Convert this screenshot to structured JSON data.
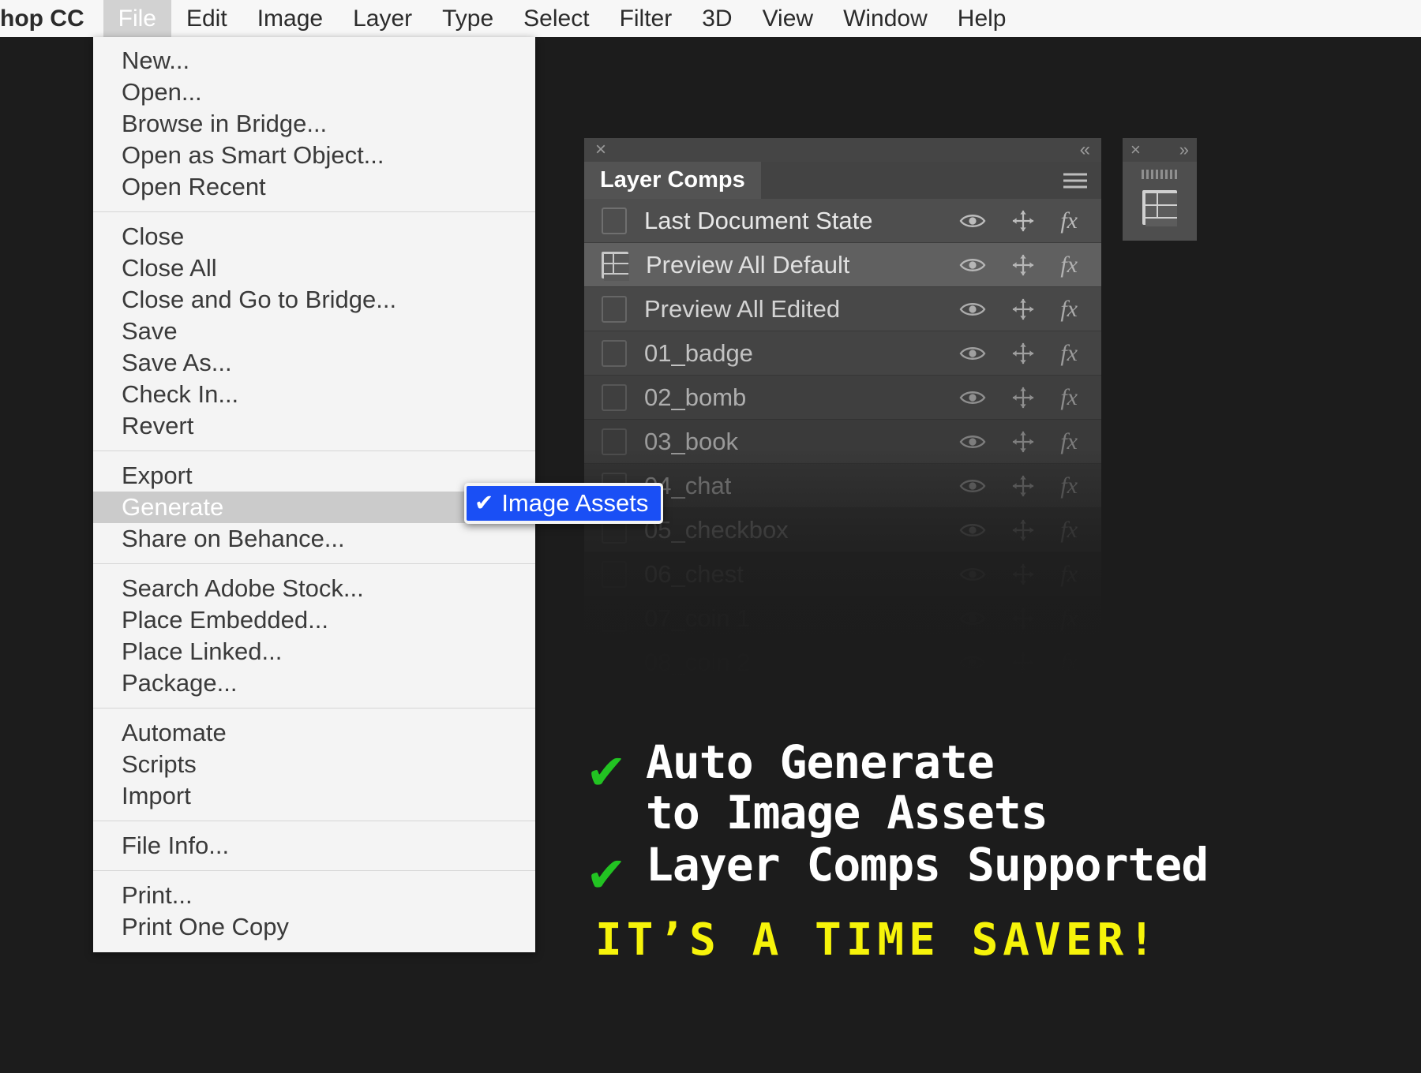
{
  "menubar": {
    "app_label": "hop CC",
    "items": [
      {
        "label": "File",
        "active": true
      },
      {
        "label": "Edit",
        "active": false
      },
      {
        "label": "Image",
        "active": false
      },
      {
        "label": "Layer",
        "active": false
      },
      {
        "label": "Type",
        "active": false
      },
      {
        "label": "Select",
        "active": false
      },
      {
        "label": "Filter",
        "active": false
      },
      {
        "label": "3D",
        "active": false
      },
      {
        "label": "View",
        "active": false
      },
      {
        "label": "Window",
        "active": false
      },
      {
        "label": "Help",
        "active": false
      }
    ]
  },
  "file_menu": {
    "groups": [
      [
        "New...",
        "Open...",
        "Browse in Bridge...",
        "Open as Smart Object...",
        "Open Recent"
      ],
      [
        "Close",
        "Close All",
        "Close and Go to Bridge...",
        "Save",
        "Save As...",
        "Check In...",
        "Revert"
      ],
      [
        "Export",
        "Generate",
        "Share on Behance..."
      ],
      [
        "Search Adobe Stock...",
        "Place Embedded...",
        "Place Linked...",
        "Package..."
      ],
      [
        "Automate",
        "Scripts",
        "Import"
      ],
      [
        "File Info..."
      ],
      [
        "Print...",
        "Print One Copy"
      ]
    ],
    "highlighted_item": "Generate",
    "submenu_arrow_item": "Generate"
  },
  "submenu": {
    "checkmark": "✔",
    "item_label": "Image Assets",
    "highlight_color": "#1a4ff5"
  },
  "layer_comps_panel": {
    "close_label": "×",
    "collapse_label": "«",
    "tab_label": "Layer Comps",
    "menu_icon": "hamburger-icon",
    "rows": [
      {
        "label": "Last Document State",
        "selected": false,
        "has_comp_icon": false
      },
      {
        "label": "Preview All Default",
        "selected": true,
        "has_comp_icon": true
      },
      {
        "label": "Preview All Edited",
        "selected": false,
        "has_comp_icon": false
      },
      {
        "label": "01_badge",
        "selected": false,
        "has_comp_icon": false
      },
      {
        "label": "02_bomb",
        "selected": false,
        "has_comp_icon": false
      },
      {
        "label": "03_book",
        "selected": false,
        "has_comp_icon": false
      },
      {
        "label": "04_chat",
        "selected": false,
        "has_comp_icon": false
      },
      {
        "label": "05_checkbox",
        "selected": false,
        "has_comp_icon": false
      },
      {
        "label": "06_chest",
        "selected": false,
        "has_comp_icon": false
      },
      {
        "label": "07_coin 1",
        "selected": false,
        "has_comp_icon": false
      },
      {
        "label": "08_coin 2",
        "selected": false,
        "has_comp_icon": false
      }
    ],
    "row_icons": [
      "eye-icon",
      "move-icon",
      "fx-icon"
    ],
    "fx_label": "fx"
  },
  "mini_panel": {
    "close_label": "×",
    "expand_label": "»",
    "icon_name": "layer-comp-icon"
  },
  "promo": {
    "lines": [
      {
        "check": "✔",
        "text": "Auto Generate\nto Image Assets"
      },
      {
        "check": "✔",
        "text": "Layer Comps Supported"
      }
    ],
    "tagline": "IT’S A TIME SAVER!",
    "check_color": "#22c322",
    "tagline_color": "#f6f30a"
  }
}
